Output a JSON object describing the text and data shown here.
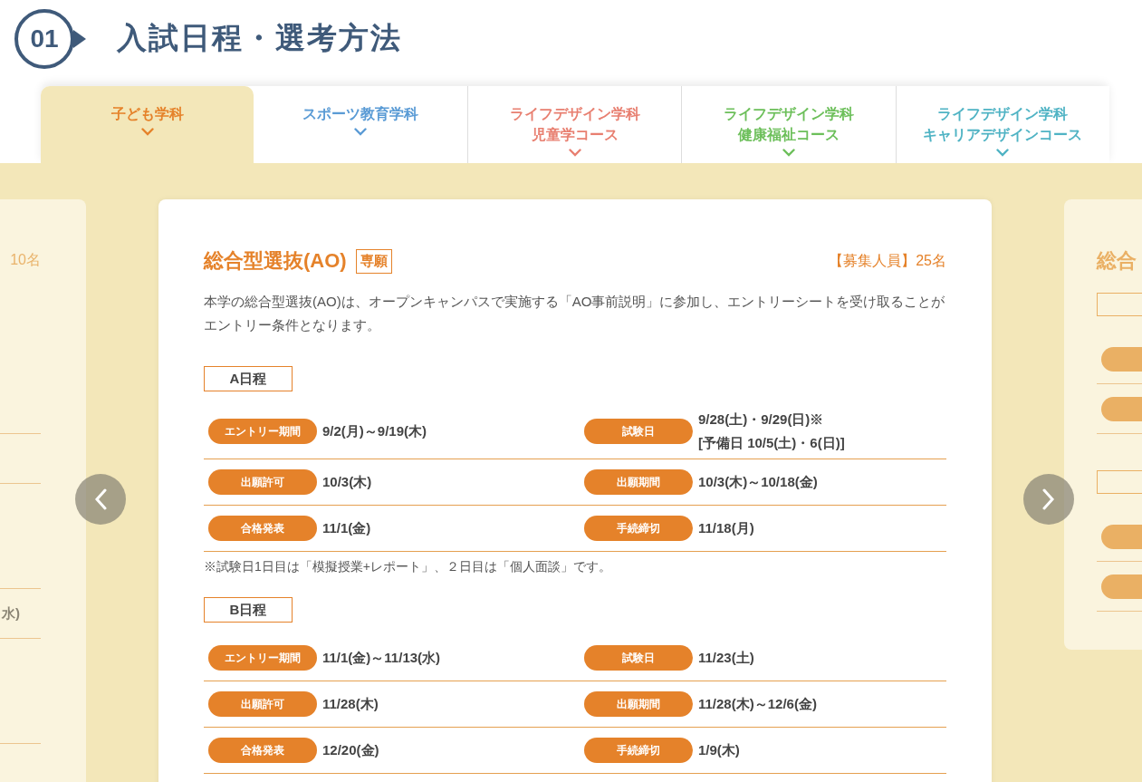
{
  "section": {
    "number": "01",
    "title": "入試日程・選考方法"
  },
  "tabs": [
    {
      "lines": [
        "子ども学科"
      ],
      "color": "#e5822a",
      "selected": true
    },
    {
      "lines": [
        "スポーツ教育学科"
      ],
      "color": "#5a9bd5",
      "selected": false
    },
    {
      "lines": [
        "ライフデザイン学科",
        "児童学コース"
      ],
      "color": "#e87f70",
      "selected": false
    },
    {
      "lines": [
        "ライフデザイン学科",
        "健康福祉コース"
      ],
      "color": "#6cbf5a",
      "selected": false
    },
    {
      "lines": [
        "ライフデザイン学科",
        "キャリアデザインコース"
      ],
      "color": "#4fb3c4",
      "selected": false
    }
  ],
  "carousel": {
    "prev_card": {
      "quota": "10名",
      "fragment": "水)"
    },
    "current_card": {
      "title": "総合型選抜(AO)",
      "tag": "専願",
      "quota": "【募集人員】25名",
      "description": "本学の総合型選抜(AO)は、オープンキャンパスで実施する「AO事前説明」に参加し、エントリーシートを受け取ることがエントリー条件となります。",
      "schedules": [
        {
          "label": "A日程",
          "items": [
            {
              "name": "エントリー期間",
              "value": [
                "9/2(月)～9/19(木)"
              ]
            },
            {
              "name": "試験日",
              "value": [
                "9/28(土)・9/29(日)※",
                "[予備日 10/5(土)・6(日)]"
              ]
            },
            {
              "name": "出願許可",
              "value": [
                "10/3(木)"
              ]
            },
            {
              "name": "出願期間",
              "value": [
                "10/3(木)～10/18(金)"
              ]
            },
            {
              "name": "合格発表",
              "value": [
                "11/1(金)"
              ]
            },
            {
              "name": "手続締切",
              "value": [
                "11/18(月)"
              ]
            }
          ],
          "note": "※試験日1日目は「模擬授業+レポート」、２日目は「個人面談」です。"
        },
        {
          "label": "B日程",
          "items": [
            {
              "name": "エントリー期間",
              "value": [
                "11/1(金)～11/13(水)"
              ]
            },
            {
              "name": "試験日",
              "value": [
                "11/23(土)"
              ]
            },
            {
              "name": "出願許可",
              "value": [
                "11/28(木)"
              ]
            },
            {
              "name": "出願期間",
              "value": [
                "11/28(木)～12/6(金)"
              ]
            },
            {
              "name": "合格発表",
              "value": [
                "12/20(金)"
              ]
            },
            {
              "name": "手続締切",
              "value": [
                "1/9(木)"
              ]
            }
          ]
        }
      ]
    },
    "next_card": {
      "title": "総合"
    }
  }
}
